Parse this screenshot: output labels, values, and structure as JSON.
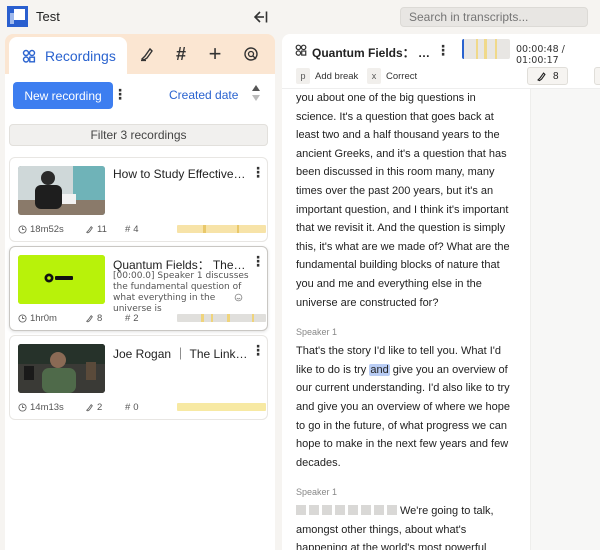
{
  "app": {
    "title": "Test"
  },
  "search": {
    "placeholder": "Search in transcripts..."
  },
  "tabs": {
    "active_label": "Recordings",
    "others": [
      "highlighter-icon",
      "hash-icon",
      "plus-icon",
      "smart-icon"
    ]
  },
  "toolbar": {
    "new_recording": "New recording",
    "sort_label": "Created date"
  },
  "filter": {
    "label": "Filter 3 recordings"
  },
  "recordings": [
    {
      "title": "How to Study Effectively ...",
      "snippet": "",
      "duration": "18m52s",
      "highlights": "11",
      "tags": "4",
      "thumb": "study",
      "bar": "#f7e3a8"
    },
    {
      "title": "Quantum Fields： The Re...",
      "snippet": "[00:00.0] Speaker 1 discusses the fundamental question of what everything in the universe is",
      "duration": "1hr0m",
      "highlights": "8",
      "tags": "2",
      "thumb": "quantum",
      "bar": "#e0dfdc"
    },
    {
      "title": "Joe Rogan ｜ The Link B...",
      "snippet": "",
      "duration": "14m13s",
      "highlights": "2",
      "tags": "0",
      "thumb": "rogan",
      "bar": "#f7e9a3"
    }
  ],
  "player": {
    "title": "Quantum Fields： Th...",
    "time": "00:00:48 / 01:00:17",
    "progress": 0.013,
    "add_break_key": "p",
    "add_break": "Add break",
    "correct_key": "x",
    "correct": "Correct",
    "highlight_count": "8"
  },
  "transcript": {
    "p1": "you about one of the big questions in science. It's a question that goes back at least two and a half thousand years to the ancient Greeks, and it's a question that has been discussed in this room many, many times over the past 200 years, but it's an important question, and I think it's important that we revisit it. And the question is simply this, it's what are we made of? What are the fundamental building blocks of nature that you and me and everything else in the universe are constructed for?",
    "speaker2": "Speaker 1",
    "p2_before": "That's the story I'd like to tell you. What I'd like to do is try ",
    "p2_hl": "and",
    "p2_after": " give you an overview of our current understanding. I'd also like to try and give you an overview of where we hope to go in the future, of what progress we can hope to make in the next few years and few decades.",
    "speaker3": "Speaker 1",
    "p3": "We're going to talk, amongst other things, about what's happening at the world's most powerful"
  },
  "colors": {
    "accent": "#3d7ef0",
    "panel": "#fbe6d2",
    "highlight": "#b9cdf5"
  }
}
